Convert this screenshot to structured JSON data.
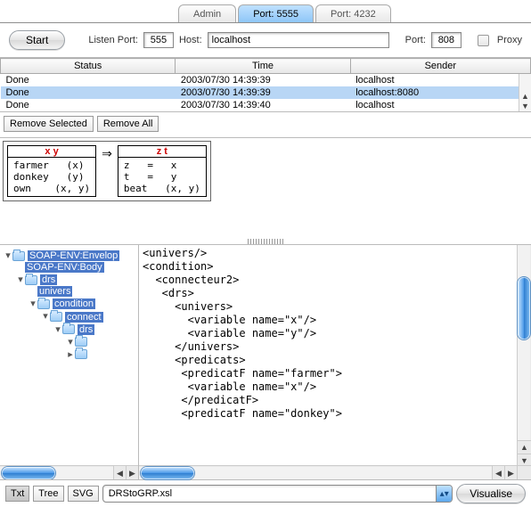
{
  "tabs": [
    "Admin",
    "Port: 5555",
    "Port: 4232"
  ],
  "active_tab_index": 1,
  "controls": {
    "start_label": "Start",
    "listen_port_label": "Listen Port:",
    "listen_port_value": "555",
    "host_label": "Host:",
    "host_value": "localhost",
    "port_label": "Port:",
    "port_value": "808",
    "proxy_label": "Proxy"
  },
  "table": {
    "columns": [
      "Status",
      "Time",
      "Sender"
    ],
    "rows": [
      {
        "status": "Done",
        "time": "2003/07/30 14:39:39",
        "sender": "localhost",
        "selected": false
      },
      {
        "status": "Done",
        "time": "2003/07/30 14:39:39",
        "sender": "localhost:8080",
        "selected": true
      },
      {
        "status": "Done",
        "time": "2003/07/30 14:39:40",
        "sender": "localhost",
        "selected": false
      }
    ]
  },
  "buttons": {
    "remove_selected": "Remove Selected",
    "remove_all": "Remove All"
  },
  "diagram": {
    "left_header": "x   y",
    "left_body": "farmer   (x)\ndonkey   (y)\nown    (x, y)",
    "right_header": "z   t",
    "right_body": "z   =   x\nt   =   y\nbeat   (x, y)"
  },
  "tree": {
    "root": "SOAP-ENV:Envelop",
    "items": [
      "SOAP-ENV:Body",
      "drs",
      "univers",
      "condition",
      "connect",
      "drs"
    ]
  },
  "xml_lines": [
    "<univers/>",
    "<condition>",
    "  <connecteur2>",
    "   <drs>",
    "     <univers>",
    "       <variable name=\"x\"/>",
    "       <variable name=\"y\"/>",
    "     </univers>",
    "     <predicats>",
    "      <predicatF name=\"farmer\">",
    "       <variable name=\"x\"/>",
    "      </predicatF>",
    "      <predicatF name=\"donkey\">"
  ],
  "footer": {
    "toggles": [
      "Txt",
      "Tree",
      "SVG"
    ],
    "active_toggle": 0,
    "combo_value": "DRStoGRP.xsl",
    "visualise_label": "Visualise"
  }
}
